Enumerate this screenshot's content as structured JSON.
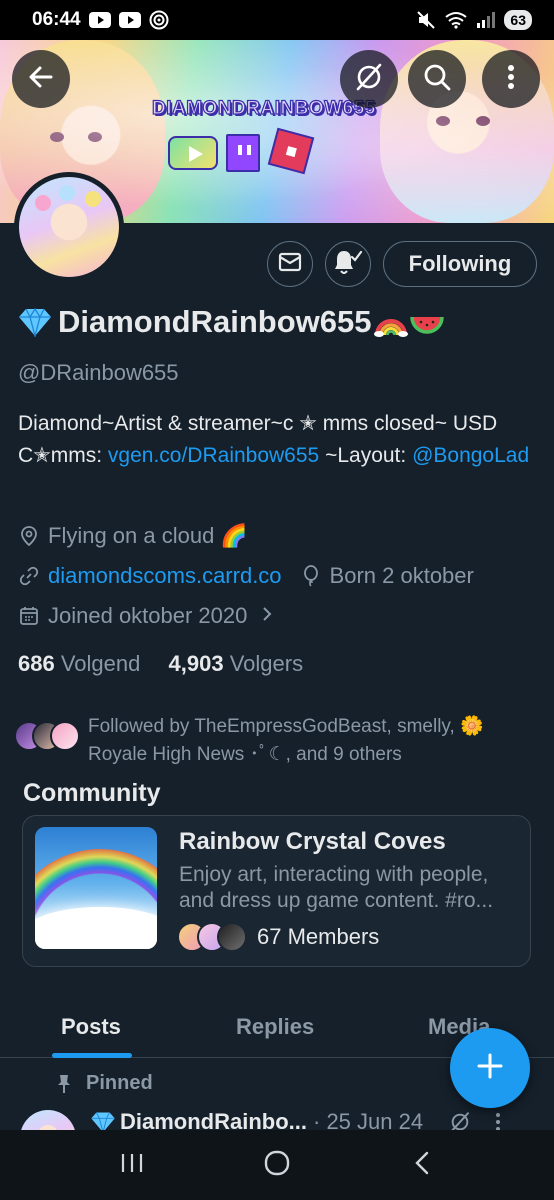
{
  "status_bar": {
    "time": "06:44",
    "battery": "63",
    "icons": [
      "youtube-icon",
      "youtube-icon",
      "signal-hotspot-icon",
      "mute-icon",
      "wifi-icon",
      "cell-signal-icon"
    ]
  },
  "banner": {
    "logo_text": "DIAMONDRAINBOW655",
    "platform_icons": [
      "youtube-icon",
      "twitch-icon",
      "roblox-icon"
    ]
  },
  "header_buttons": {
    "back": "arrow-left-icon",
    "grok": "grok-icon",
    "search": "search-icon",
    "more": "more-vertical-icon"
  },
  "profile": {
    "display_name": "DiamondRainbow655",
    "handle": "@DRainbow655",
    "bio_part1": "Diamond~Artist & streamer~c ✭ mms closed~ USD C✭mms: ",
    "bio_link": "vgen.co/DRainbow655",
    "bio_part2": " ~Layout: ",
    "bio_mention": "@BongoLad",
    "location": "Flying on a cloud 🌈",
    "website": "diamondscoms.carrd.co",
    "birthday": "Born 2 oktober",
    "joined": "Joined oktober 2020",
    "following_count": "686",
    "following_label": "Volgend",
    "followers_count": "4,903",
    "followers_label": "Volgers",
    "followed_by": "Followed by TheEmpressGodBeast, smelly, 🌼 Royale High News ･ﾟ☾, and 9 others"
  },
  "actions": {
    "message": "mail-icon",
    "notifications": "bell-check-icon",
    "following_label": "Following"
  },
  "community": {
    "section_title": "Community",
    "name": "Rainbow Crystal Coves",
    "desc_line1": "Enjoy art, interacting with people,",
    "desc_line2": "and dress up game content. #ro...",
    "members": "67 Members"
  },
  "tabs": [
    {
      "label": "Posts",
      "active": true
    },
    {
      "label": "Replies",
      "active": false
    },
    {
      "label": "Media",
      "active": false
    }
  ],
  "pinned": {
    "label": "Pinned",
    "author": "DiamondRainbo...",
    "date": "· 25 Jun 24"
  },
  "fab": "plus-icon",
  "colors": {
    "background": "#15202b",
    "accent": "#1d9bf0",
    "text_primary": "#e7e9ea",
    "text_secondary": "#8b98a5",
    "border": "#38444d"
  }
}
